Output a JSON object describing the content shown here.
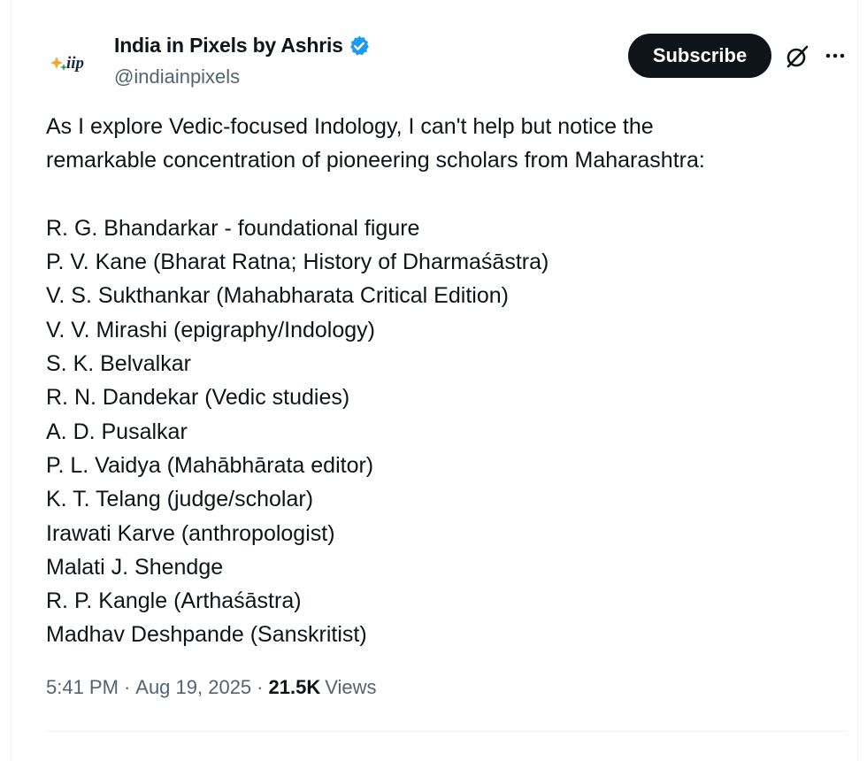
{
  "author": {
    "name": "India in Pixels by Ashris",
    "handle": "@indiainpixels",
    "verified": true,
    "avatar_text": "iip"
  },
  "actions": {
    "subscribe_label": "Subscribe",
    "grok_icon": "grok-icon",
    "more_icon": "more-dots-icon"
  },
  "tweet": {
    "intro_line1": "As I explore Vedic-focused Indology, I can't help but notice the",
    "intro_line2": "remarkable concentration of pioneering scholars from Maharashtra:",
    "scholars": [
      "R. G. Bhandarkar - foundational figure",
      "P. V. Kane (Bharat Ratna; History of Dharmaśāstra)",
      "V. S. Sukthankar (Mahabharata Critical Edition)",
      "V. V. Mirashi (epigraphy/Indology)",
      "S. K. Belvalkar",
      "R. N. Dandekar (Vedic studies)",
      "A. D. Pusalkar",
      "P. L. Vaidya (Mahābhārata editor)",
      "K. T. Telang (judge/scholar)",
      "Irawati Karve (anthropologist)",
      "Malati J. Shendge",
      "R. P. Kangle (Arthaśāstra)",
      "Madhav Deshpande (Sanskritist)"
    ]
  },
  "meta": {
    "time": "5:41 PM",
    "separator": "·",
    "date": "Aug 19, 2025",
    "views_count": "21.5K",
    "views_label": "Views"
  },
  "colors": {
    "text": "#0f1419",
    "secondary": "#536471",
    "verified": "#1d9bf0",
    "button_bg": "#0f1419",
    "border": "#eff3f4"
  }
}
